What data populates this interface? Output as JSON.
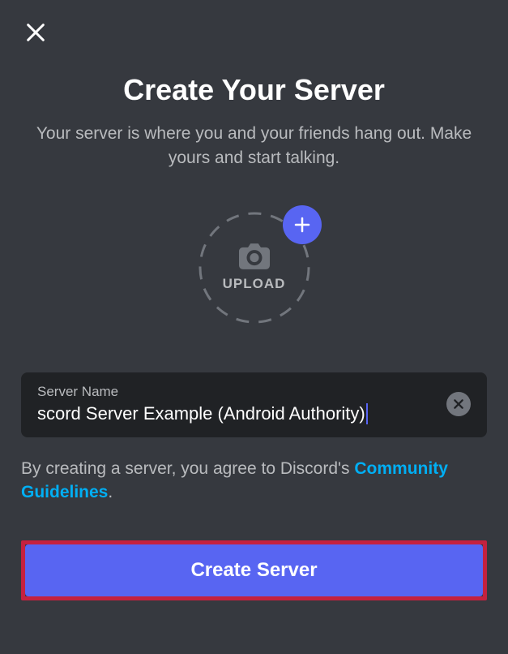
{
  "header": {
    "title": "Create Your Server",
    "subtitle": "Your server is where you and your friends hang out. Make yours and start talking."
  },
  "upload": {
    "label": "UPLOAD"
  },
  "input": {
    "label": "Server Name",
    "value": "scord Server Example (Android Authority)"
  },
  "agreement": {
    "text_before": "By creating a server, you agree to Discord's ",
    "link_text": "Community Guidelines",
    "text_after": "."
  },
  "button": {
    "create_label": "Create Server"
  }
}
